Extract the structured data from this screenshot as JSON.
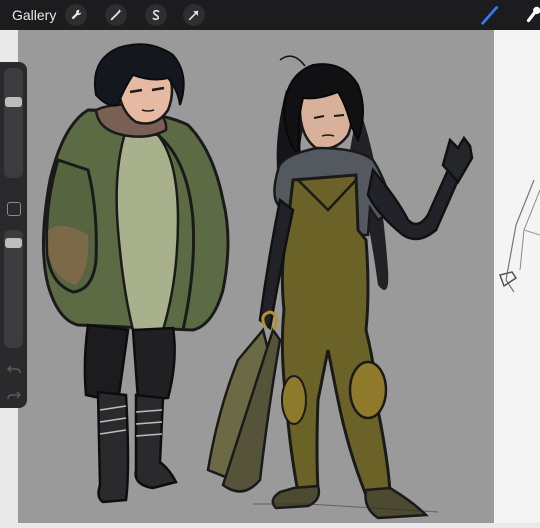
{
  "topbar": {
    "gallery_label": "Gallery",
    "tools": [
      {
        "icon": "wrench-icon"
      },
      {
        "icon": "magic-wand-icon"
      },
      {
        "icon": "selection-s-icon"
      },
      {
        "icon": "transform-arrow-icon"
      }
    ],
    "right_tools": [
      {
        "icon": "brush-icon",
        "active": true,
        "color": "#2f7cf6"
      },
      {
        "icon": "smudge-icon",
        "active": false,
        "color": "#ffffff"
      }
    ]
  },
  "sidebar": {
    "brush_size_level": 0.65,
    "opacity_level": 0.9,
    "undo_icon": "undo-icon",
    "redo_icon": "redo-icon"
  },
  "colors": {
    "topbar_bg": "#1c1c1e",
    "canvas_gray": "#9a9a9a",
    "accent_blue": "#2f7cf6"
  }
}
